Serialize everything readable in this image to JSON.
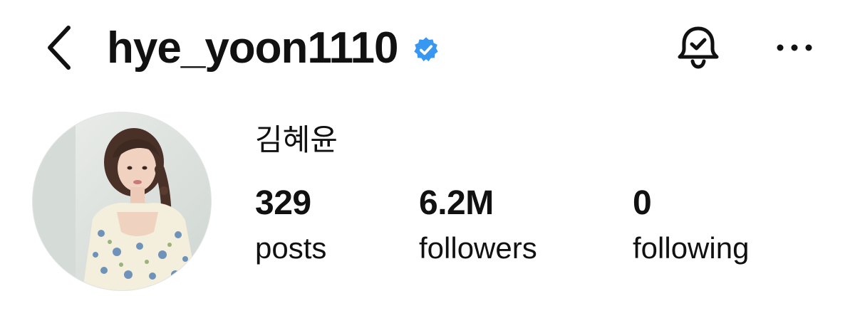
{
  "header": {
    "username": "hye_yoon1110",
    "verified": true,
    "verified_color": "#3897f0",
    "back_icon": "chevron-left-icon",
    "bell_icon": "bell-check-icon",
    "more_icon": "more-horizontal-icon"
  },
  "profile": {
    "display_name": "김혜윤",
    "avatar": "profile-photo"
  },
  "stats": {
    "posts": {
      "value": "329",
      "label": "posts"
    },
    "followers": {
      "value": "6.2M",
      "label": "followers"
    },
    "following": {
      "value": "0",
      "label": "following"
    }
  }
}
